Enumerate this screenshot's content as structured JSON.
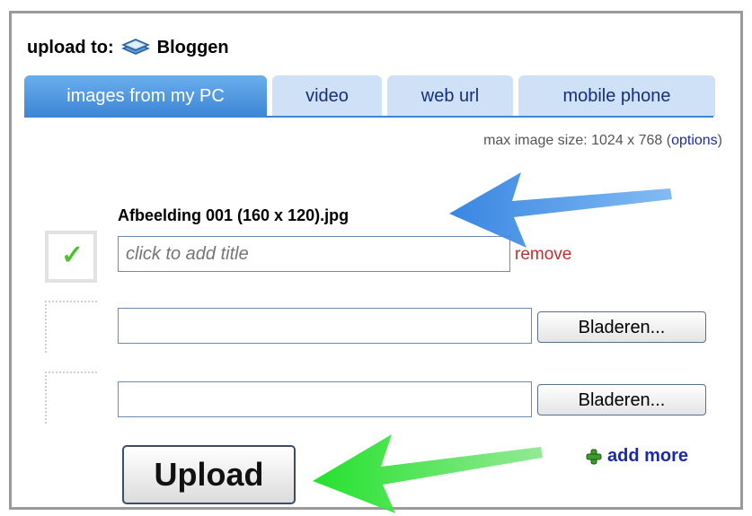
{
  "header": {
    "prefix": "upload to:",
    "blog_name": "Bloggen",
    "icon": "blogger-stack-icon"
  },
  "tabs": [
    {
      "label": "images from my PC",
      "active": true
    },
    {
      "label": "video",
      "active": false
    },
    {
      "label": "web url",
      "active": false
    },
    {
      "label": "mobile phone",
      "active": false
    }
  ],
  "max_size": {
    "text": "max image size: 1024 x 768 (",
    "options_link": "options",
    "close": ")"
  },
  "uploaded_file": {
    "filename": "Afbeelding 001 (160 x 120).jpg",
    "title_placeholder": "click to add title",
    "remove_label": "remove"
  },
  "file_inputs": [
    {
      "browse_label": "Bladeren..."
    },
    {
      "browse_label": "Bladeren..."
    }
  ],
  "upload_button": "Upload",
  "add_more": "add more",
  "colors": {
    "tab_active": "#3d86d6",
    "tab_inactive": "#cfe1f6",
    "arrow_blue": "#3b8fe6",
    "arrow_green": "#2fd43a"
  }
}
